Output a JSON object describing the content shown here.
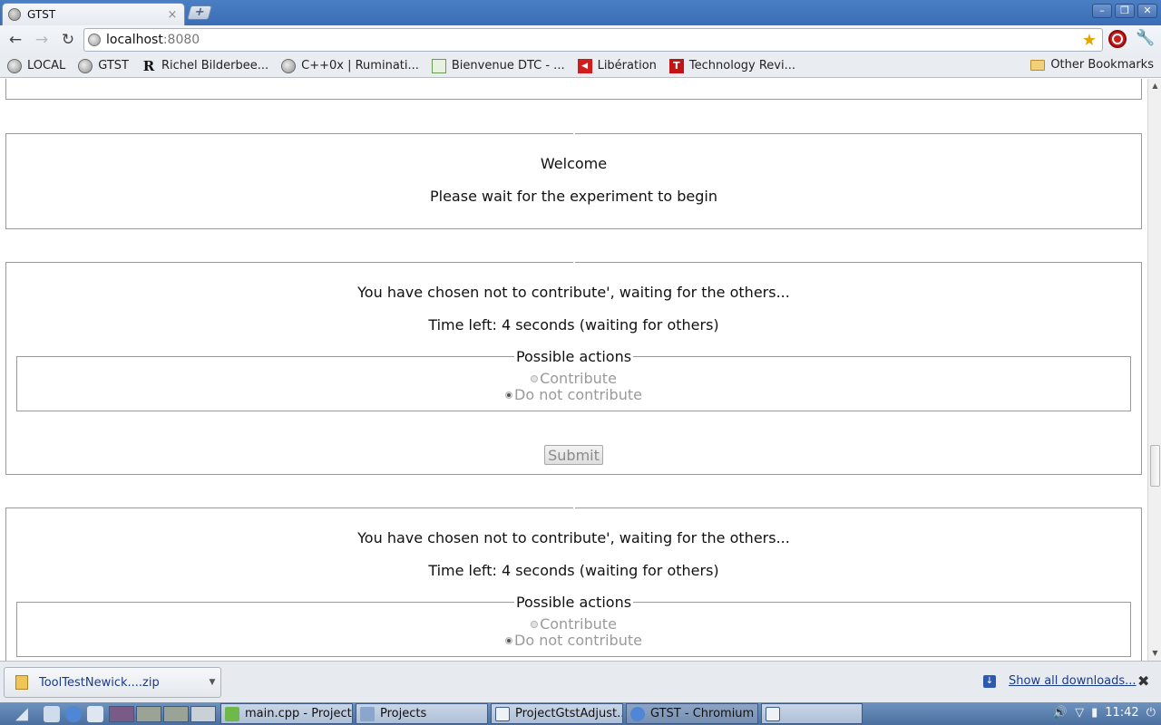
{
  "browser": {
    "tab_title": "GTST",
    "tab_close": "×",
    "new_tab": "+",
    "window_buttons": [
      "–",
      "❐",
      "✕"
    ],
    "nav": {
      "back": "←",
      "forward": "→",
      "reload": "↻"
    },
    "url_host": "localhost",
    "url_port": ":8080",
    "star": "★",
    "wrench": "🔧"
  },
  "bookmarks": [
    {
      "label": "LOCAL",
      "icon": "globe-icon"
    },
    {
      "label": "GTST",
      "icon": "globe-icon"
    },
    {
      "label": "Richel Bilderbee...",
      "icon": "r-icon"
    },
    {
      "label": "C++0x | Ruminati...",
      "icon": "globe-icon"
    },
    {
      "label": "Bienvenue DTC - ...",
      "icon": "page-icon"
    },
    {
      "label": "Libération",
      "icon": "liberation-icon"
    },
    {
      "label": "Technology Revi...",
      "icon": "tr-icon"
    }
  ],
  "other_bookmarks": "Other Bookmarks",
  "page": {
    "welcome": {
      "title": "Welcome",
      "message": "Please wait for the experiment to begin"
    },
    "round1": {
      "status": "You have chosen not to contribute', waiting for the others...",
      "time_left": "Time left: 4 seconds (waiting for others)",
      "legend": "Possible actions",
      "option_contribute": "Contribute",
      "option_not_contribute": "Do not contribute",
      "selected": "Do not contribute",
      "submit": "Submit"
    },
    "round2": {
      "status": "You have chosen not to contribute', waiting for the others...",
      "time_left": "Time left: 4 seconds (waiting for others)",
      "legend": "Possible actions",
      "option_contribute": "Contribute",
      "option_not_contribute": "Do not contribute",
      "selected": "Do not contribute"
    }
  },
  "downloads": {
    "file": "ToolTestNewick....zip",
    "show_all": "Show all downloads...",
    "close": "✖"
  },
  "taskbar": {
    "tasks": [
      {
        "label": "main.cpp - Project...",
        "icon": "qt-icon"
      },
      {
        "label": "Projects",
        "icon": "folder-icon"
      },
      {
        "label": "ProjectGtstAdjust...",
        "icon": "document-icon"
      },
      {
        "label": "GTST - Chromium",
        "icon": "chromium-icon",
        "active": true
      },
      {
        "label": "",
        "icon": "document-icon"
      }
    ],
    "clock": "11:42",
    "workspace_colors": [
      "#7a5a86",
      "#9aa396",
      "#9aa396",
      "#c9d0d6"
    ]
  }
}
